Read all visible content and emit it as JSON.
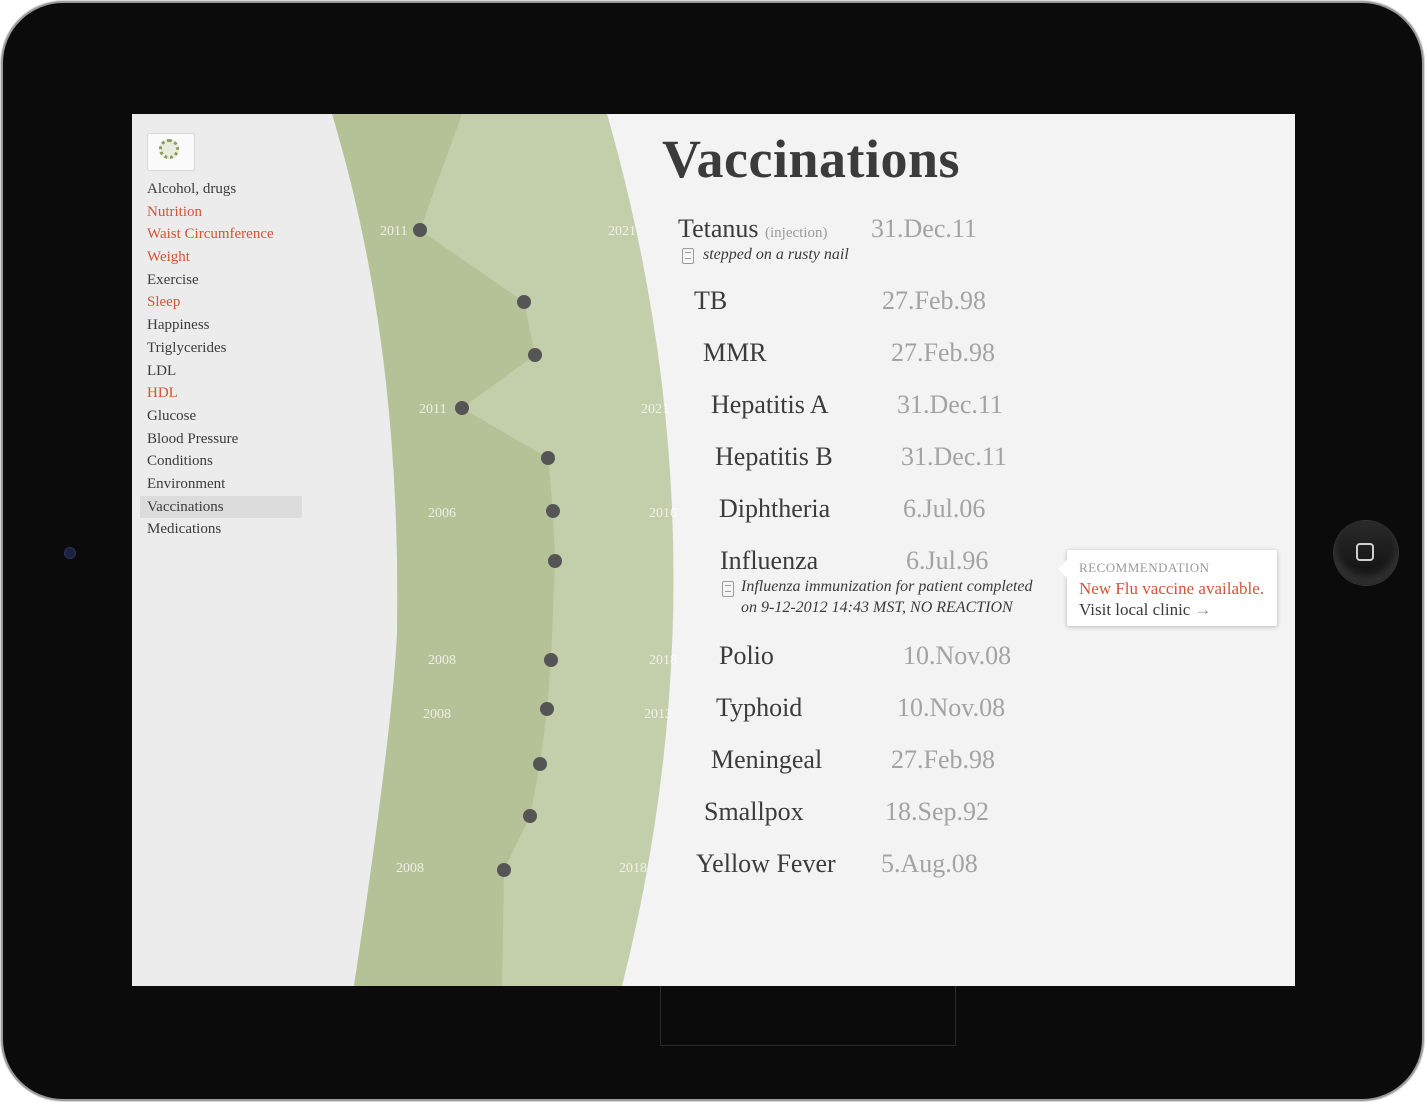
{
  "sidebar": {
    "items": [
      {
        "label": "Alcohol, drugs",
        "alert": false,
        "active": false
      },
      {
        "label": "Nutrition",
        "alert": true,
        "active": false
      },
      {
        "label": "Waist Circumference",
        "alert": true,
        "active": false
      },
      {
        "label": "Weight",
        "alert": true,
        "active": false
      },
      {
        "label": "Exercise",
        "alert": false,
        "active": false
      },
      {
        "label": "Sleep",
        "alert": true,
        "active": false
      },
      {
        "label": "Happiness",
        "alert": false,
        "active": false
      },
      {
        "label": "Triglycerides",
        "alert": false,
        "active": false
      },
      {
        "label": "LDL",
        "alert": false,
        "active": false
      },
      {
        "label": "HDL",
        "alert": true,
        "active": false
      },
      {
        "label": "Glucose",
        "alert": false,
        "active": false
      },
      {
        "label": "Blood Pressure",
        "alert": false,
        "active": false
      },
      {
        "label": "Conditions",
        "alert": false,
        "active": false
      },
      {
        "label": "Environment",
        "alert": false,
        "active": false
      },
      {
        "label": "Vaccinations",
        "alert": false,
        "active": true
      },
      {
        "label": "Medications",
        "alert": false,
        "active": false
      }
    ]
  },
  "page": {
    "title": "Vaccinations"
  },
  "vaccinations": [
    {
      "name": "Tetanus",
      "route": "(injection)",
      "date": "31.Dec.11",
      "note": "stepped on a rusty nail"
    },
    {
      "name": "TB",
      "date": "27.Feb.98"
    },
    {
      "name": "MMR",
      "date": "27.Feb.98"
    },
    {
      "name": "Hepatitis A",
      "date": "31.Dec.11"
    },
    {
      "name": "Hepatitis B",
      "date": "31.Dec.11"
    },
    {
      "name": "Diphtheria",
      "date": "6.Jul.06"
    },
    {
      "name": "Influenza",
      "date": "6.Jul.96",
      "note_line1": "Influenza immunization for patient completed",
      "note_line2": "on 9-12-2012 14:43 MST, NO REACTION"
    },
    {
      "name": "Polio",
      "date": "10.Nov.08"
    },
    {
      "name": "Typhoid",
      "date": "10.Nov.08"
    },
    {
      "name": "Meningeal",
      "date": "27.Feb.98"
    },
    {
      "name": "Smallpox",
      "date": "18.Sep.92"
    },
    {
      "name": "Yellow Fever",
      "date": "5.Aug.08"
    }
  ],
  "timeline": {
    "year_labels": [
      {
        "start": "2011",
        "end": "2021"
      },
      {
        "start": "2011",
        "end": "2021"
      },
      {
        "start": "2006",
        "end": "2016"
      },
      {
        "start": "2008",
        "end": "2018"
      },
      {
        "start": "2008",
        "end": "2013"
      },
      {
        "start": "2008",
        "end": "2018"
      }
    ],
    "band_color_outer": "#c3ceaa",
    "band_color_inner": "#b5c297",
    "marker_color": "#555555"
  },
  "recommendation": {
    "heading": "RECOMMENDATION",
    "message": "New Flu vaccine available.",
    "link_label": "Visit local clinic",
    "arrow": "→"
  },
  "colors": {
    "alert": "#d65336",
    "text": "#3b3b3b",
    "muted": "#a3a3a3"
  }
}
